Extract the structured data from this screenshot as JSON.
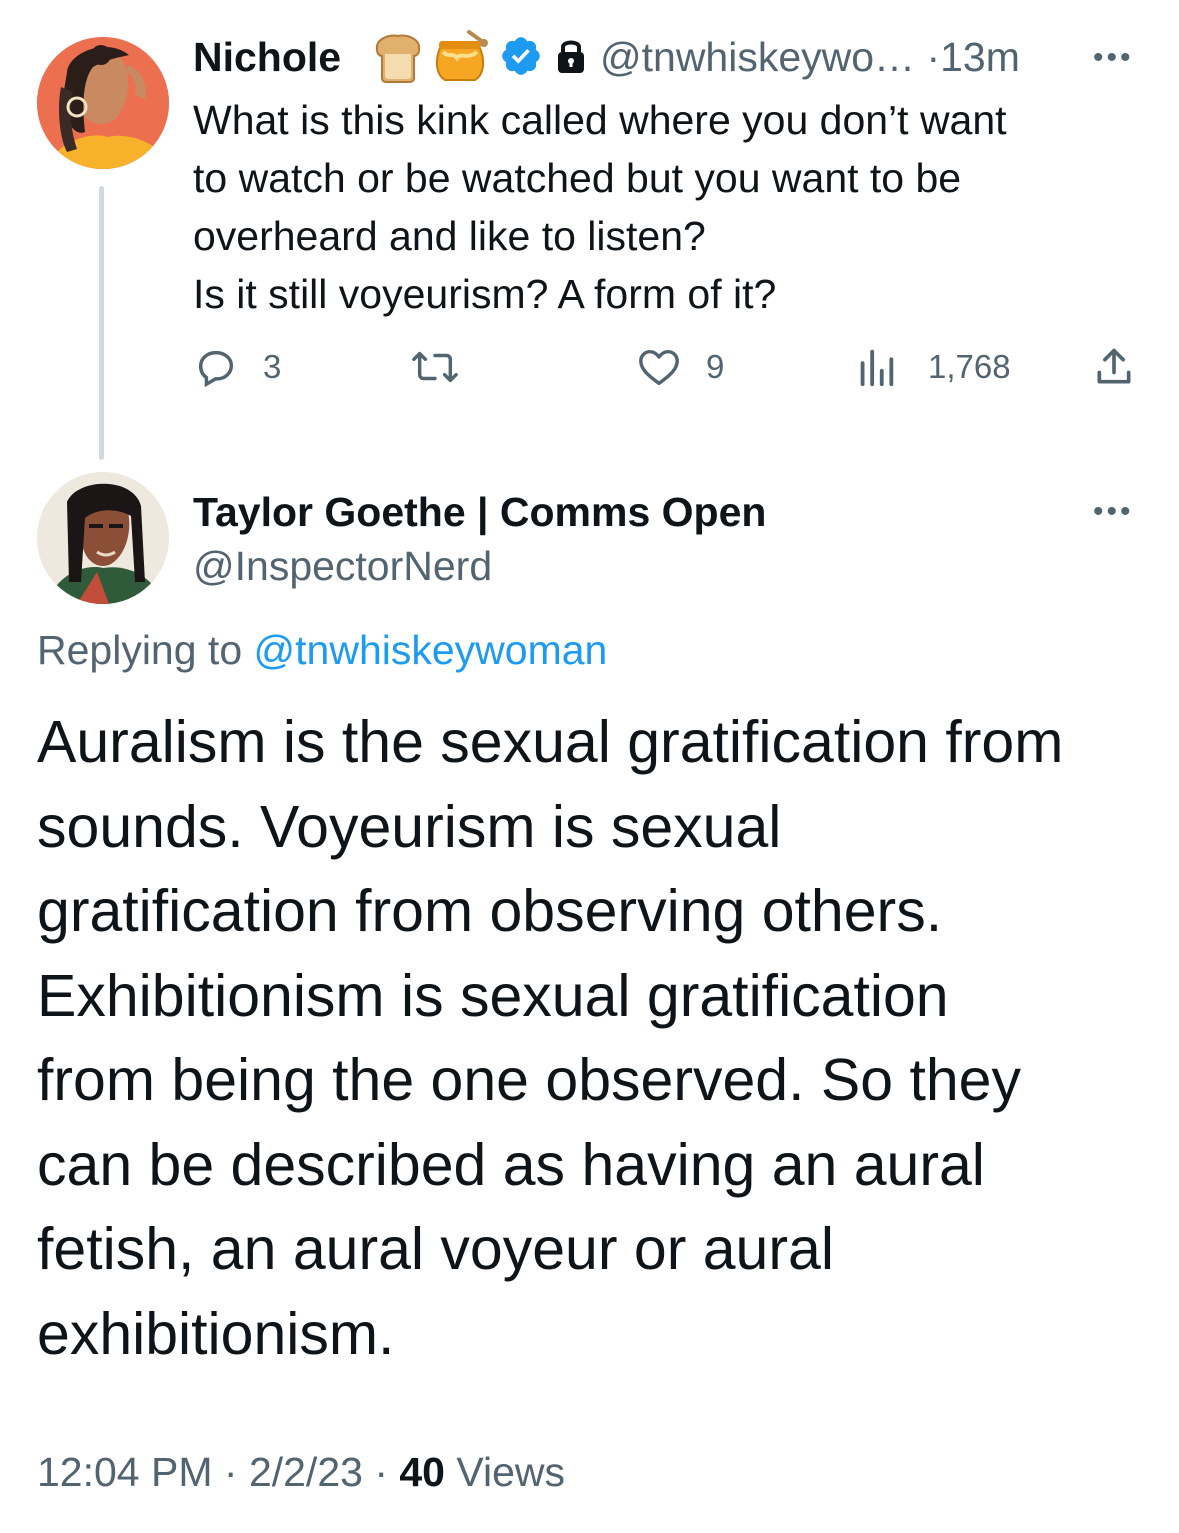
{
  "parent_tweet": {
    "author_name": "Nichole",
    "emojis": [
      "bread-emoji",
      "honey-pot-emoji"
    ],
    "handle": "@tnwhiskeywo…",
    "separator": "·",
    "time": "13m",
    "text": "What is this kink called where you don’t want\nto watch or be watched but you want to be\noverheard and like to listen?\nIs it still voyeurism? A form of it?",
    "actions": {
      "replies": "3",
      "retweets": "",
      "likes": "9",
      "views": "1,768"
    }
  },
  "reply_tweet": {
    "author_name": "Taylor Goethe | Comms Open",
    "handle": "@InspectorNerd",
    "replying_label": "Replying to ",
    "replying_to": "@tnwhiskeywoman",
    "text": "Auralism is the sexual gratification from\nsounds. Voyeurism is sexual\ngratification from observing others.\nExhibitionism is sexual gratification\nfrom being the one observed. So they\ncan be described as having an aural\nfetish, an aural voyeur or aural\nexhibitionism.",
    "time": "12:04 PM",
    "date": "2/2/23",
    "views_count": "40",
    "views_label": "Views"
  },
  "colors": {
    "text_primary": "#0f1419",
    "text_secondary": "#536471",
    "link": "#1d9bf0",
    "thread_line": "#cfd9de",
    "verified": "#1d9bf0"
  }
}
